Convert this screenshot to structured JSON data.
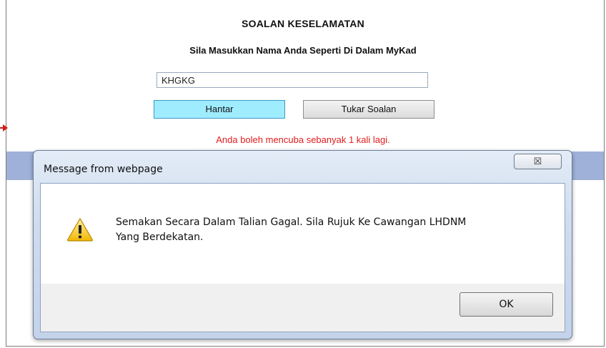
{
  "page": {
    "title": "SOALAN KESELAMATAN",
    "subtitle": "Sila Masukkan Nama Anda Seperti Di Dalam MyKad",
    "name_value": "KHGKG",
    "submit_label": "Hantar",
    "change_question_label": "Tukar Soalan",
    "attempts_warning": "Anda boleh mencuba sebanyak 1 kali lagi."
  },
  "dialog": {
    "title": "Message from webpage",
    "close_glyph": "☒",
    "icon": "warning-icon",
    "message_line1": "Semakan Secara Dalam Talian Gagal. Sila Rujuk Ke Cawangan LHDNM",
    "message_line2": "Yang Berdekatan.",
    "ok_label": "OK"
  },
  "colors": {
    "warning_text": "#e01c1c",
    "submit_button_bg": "#9fecff",
    "dialog_frame": "#c3d3ea",
    "annotation_arrow": "#d21b1b"
  }
}
